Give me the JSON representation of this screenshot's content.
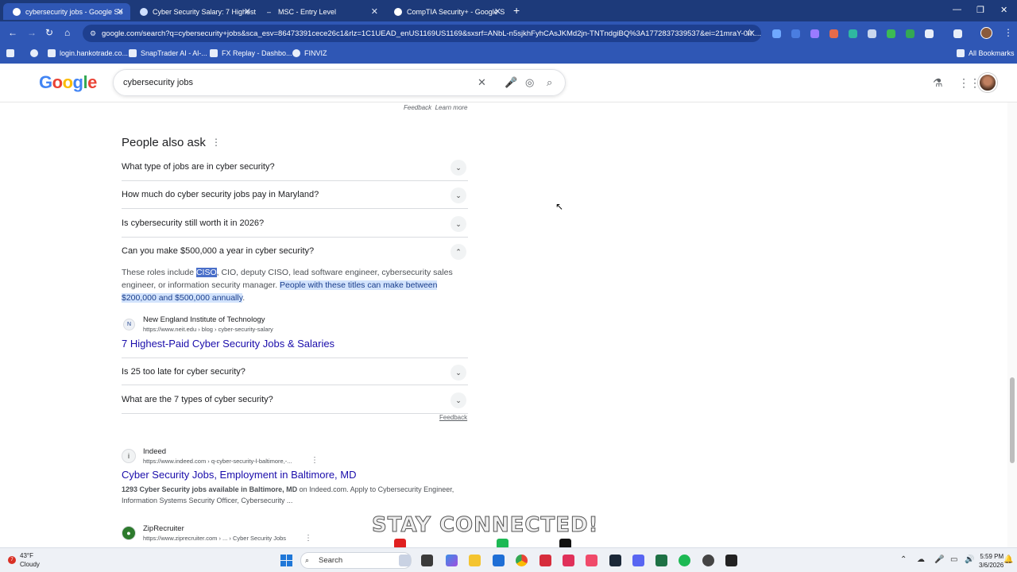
{
  "browser": {
    "tabs": [
      {
        "title": "cybersecurity jobs - Google Se",
        "active": true
      },
      {
        "title": "Cyber Security Salary: 7 Highest",
        "active": false
      },
      {
        "title": "MSC - Entry Level",
        "active": false
      },
      {
        "title": "CompTIA Security+ - Google S",
        "active": false
      }
    ],
    "url": "google.com/search?q=cybersecurity+jobs&sca_esv=86473391cece26c1&rlz=1C1UEAD_enUS1169US1169&sxsrf=ANbL-n5sjkhFyhCAsJKMd2jn-TNTndgiBQ%3A1772837339537&ei=21mraY-0IK...",
    "bookmarks": [
      "login.hankotrade.co...",
      "SnapTrader AI - Al-...",
      "FX Replay - Dashbo...",
      "FINVIZ"
    ],
    "all_bookmarks": "All Bookmarks",
    "colors": {
      "tabbar": "#1d3a7a",
      "toolbar": "#2f57b5"
    }
  },
  "google": {
    "logo": "Google",
    "query": "cybersecurity jobs",
    "feedback_top": "Feedback",
    "learn_more": "Learn more"
  },
  "paa": {
    "title": "People also ask",
    "questions": [
      "What type of jobs are in cyber security?",
      "How much do cyber security jobs pay in Maryland?",
      "Is cybersecurity still worth it in 2026?",
      "Can you make $500,000 a year in cyber security?",
      "Is 25 too late for cyber security?",
      "What are the 7 types of cyber security?"
    ],
    "answer": {
      "part1": "These roles include ",
      "highlight1": "CISO",
      "part2": ", CIO, deputy CISO, lead software engineer, cybersecurity sales engineer, or information security manager. ",
      "highlight2": "People with these titles can make between $200,000 and $500,000 annually",
      "part3": "."
    },
    "source": {
      "name": "New England Institute of Technology",
      "url": "https://www.neit.edu › blog › cyber-security-salary",
      "link": "7 Highest-Paid Cyber Security Jobs & Salaries"
    },
    "feedback": "Feedback"
  },
  "results": [
    {
      "name": "Indeed",
      "url": "https://www.indeed.com › q-cyber-security-l-baltimore,-...",
      "title": "Cyber Security Jobs, Employment in Baltimore, MD",
      "snippet_bold": "1293 Cyber Security jobs available in Baltimore, MD",
      "snippet_rest": " on Indeed.com. Apply to Cybersecurity Engineer, Information Systems Security Officer, Cybersecurity ..."
    },
    {
      "name": "ZipRecruiter",
      "url": "https://www.ziprecruiter.com › ... › Cyber Security Jobs"
    }
  ],
  "overlay": {
    "headline": "STAY CONNECTED!"
  },
  "taskbar": {
    "temp": "43°F",
    "condition": "Cloudy",
    "badge": "7",
    "search": "Search",
    "time": "5:59 PM",
    "date": "3/6/2026"
  }
}
